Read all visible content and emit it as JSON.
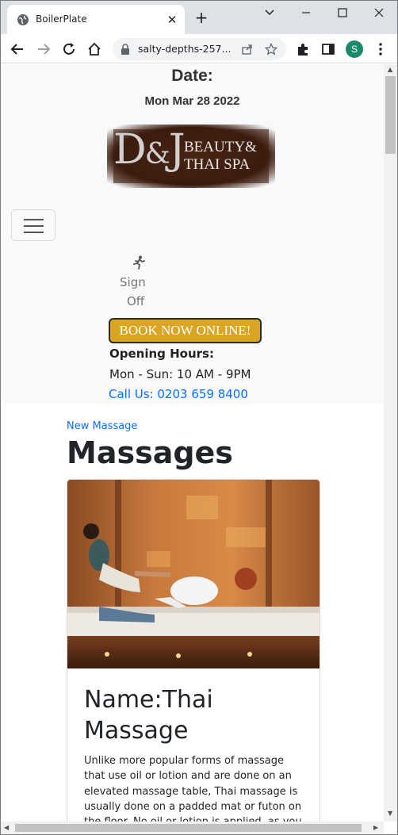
{
  "browser": {
    "tab_title": "BoilerPlate",
    "url": "salty-depths-257...",
    "profile_initial": "S"
  },
  "header": {
    "date_label": "Date:",
    "date_value": "Mon Mar 28 2022",
    "logo": {
      "letters": "D",
      "amp": "&",
      "letter2": "J",
      "line1": "BEAUTY&",
      "line2": "THAI SPA"
    },
    "signoff_line1": "Sign",
    "signoff_line2": "Off",
    "book_button": "BOOK NOW ONLINE!",
    "hours_label": "Opening Hours:",
    "hours_value": "Mon - Sun: 10 AM - 9PM",
    "call_link": "Call Us: 0203 659 8400"
  },
  "main": {
    "new_link": "New Massage",
    "title": "Massages",
    "card": {
      "title": "Name:Thai Massage",
      "text": "Unlike more popular forms of massage that use oil or lotion and are done on an elevated massage table, Thai massage is usually done on a padded mat or futon on the floor. No oil or lotion is applied, as you are fully clothed"
    }
  },
  "colors": {
    "accent": "#0d6efd",
    "book_button": "#daa520",
    "navbar_bg": "#f8f9fa"
  }
}
